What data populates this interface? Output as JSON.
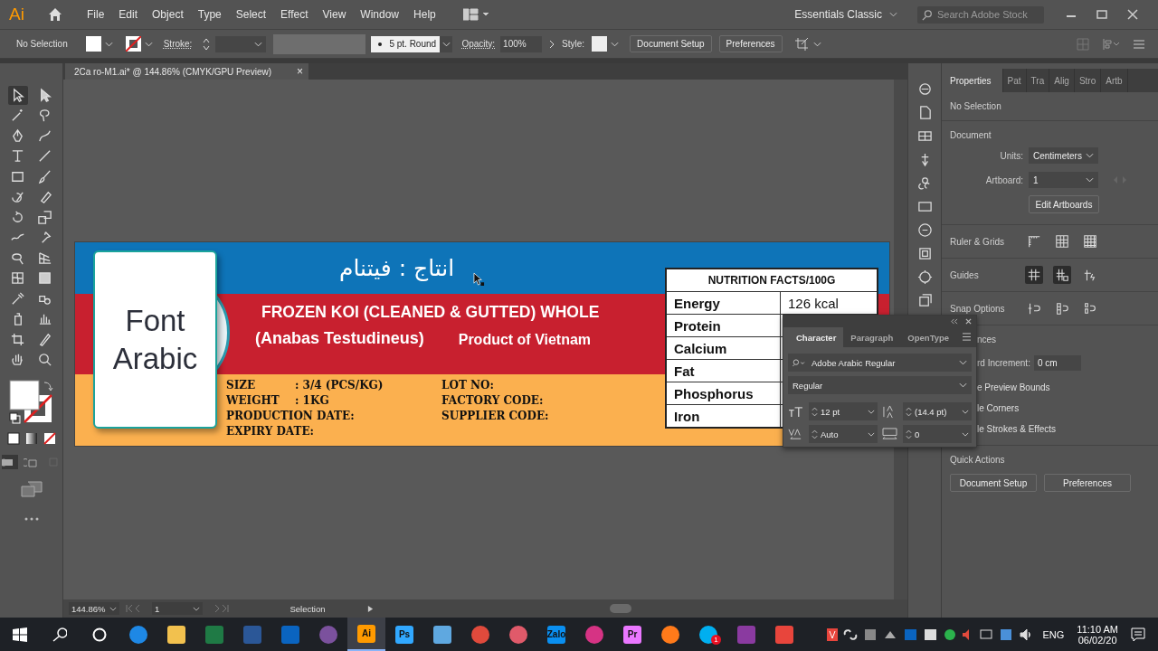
{
  "app": {
    "logo": "Ai"
  },
  "menu": [
    "File",
    "Edit",
    "Object",
    "Type",
    "Select",
    "Effect",
    "View",
    "Window",
    "Help"
  ],
  "workspace": "Essentials Classic",
  "stock_search": {
    "placeholder": "Search Adobe Stock"
  },
  "control_bar": {
    "selection": "No Selection",
    "stroke_label": "Stroke:",
    "brush": "5 pt. Round",
    "opacity_label": "Opacity:",
    "opacity": "100%",
    "style_label": "Style:",
    "buttons": [
      "Document Setup",
      "Preferences"
    ]
  },
  "document_tab": {
    "title": "2Ca ro-M1.ai* @ 144.86% (CMYK/GPU Preview)",
    "close": "×"
  },
  "tools": [
    {
      "kind": "selection",
      "selected": true
    },
    {
      "kind": "direct-selection",
      "selected": false
    },
    {
      "kind": "magic-wand",
      "selected": false
    },
    {
      "kind": "lasso",
      "selected": false
    },
    {
      "kind": "pen",
      "selected": false
    },
    {
      "kind": "curvature",
      "selected": false
    },
    {
      "kind": "type",
      "selected": false
    },
    {
      "kind": "line",
      "selected": false
    },
    {
      "kind": "rectangle",
      "selected": false
    },
    {
      "kind": "paintbrush",
      "selected": false
    },
    {
      "kind": "shaper",
      "selected": false
    },
    {
      "kind": "eraser",
      "selected": false
    },
    {
      "kind": "rotate",
      "selected": false
    },
    {
      "kind": "scale",
      "selected": false
    },
    {
      "kind": "warp",
      "selected": false
    },
    {
      "kind": "puppet-warp",
      "selected": false
    },
    {
      "kind": "free-transform",
      "selected": false
    },
    {
      "kind": "perspective-grid",
      "selected": false
    },
    {
      "kind": "mesh",
      "selected": false
    },
    {
      "kind": "gradient",
      "selected": false
    },
    {
      "kind": "eyedropper",
      "selected": false
    },
    {
      "kind": "blend",
      "selected": false
    },
    {
      "kind": "symbol-sprayer",
      "selected": false
    },
    {
      "kind": "column-graph",
      "selected": false
    },
    {
      "kind": "artboard",
      "selected": false
    },
    {
      "kind": "slice",
      "selected": false
    },
    {
      "kind": "hand",
      "selected": false
    },
    {
      "kind": "zoom",
      "selected": false
    }
  ],
  "artboard": {
    "card_text": [
      "Font",
      "Arabic"
    ],
    "arabic_title": "انتاج : فيتنام",
    "product_title": "FROZEN KOI (CLEANED & GUTTED) WHOLE",
    "species": "(Anabas Testudineus)",
    "origin": "Product of Vietnam",
    "fields_left": [
      {
        "label": "SIZE",
        "value": ": 3/4 (PCS/KG)"
      },
      {
        "label": "WEIGHT",
        "value": ": 1KG"
      },
      {
        "label": "PRODUCTION DATE:"
      },
      {
        "label": "EXPIRY DATE:"
      }
    ],
    "fields_right": [
      {
        "label": "LOT NO:"
      },
      {
        "label": "FACTORY CODE:"
      },
      {
        "label": "SUPPLIER CODE:"
      }
    ],
    "nutrition": {
      "title": "NUTRITION FACTS/100G",
      "rows": [
        {
          "name": "Energy",
          "value": "126 kcal"
        },
        {
          "name": "Protein"
        },
        {
          "name": "Calcium"
        },
        {
          "name": "Fat"
        },
        {
          "name": "Phosphorus"
        },
        {
          "name": "Iron"
        }
      ]
    }
  },
  "status_bar": {
    "zoom": "144.86%",
    "artboard": "1",
    "tool": "Selection"
  },
  "properties": {
    "tabs": [
      {
        "label": "Properties",
        "selected": true
      },
      {
        "label": "Pat",
        "selected": false
      },
      {
        "label": "Tra",
        "selected": false
      },
      {
        "label": "Alig",
        "selected": false
      },
      {
        "label": "Stro",
        "selected": false
      },
      {
        "label": "Artb",
        "selected": false
      }
    ],
    "selection": "No Selection",
    "document": {
      "heading": "Document",
      "units_label": "Units:",
      "units": "Centimeters",
      "artboard_label": "Artboard:",
      "artboard": "1",
      "button": "Edit Artboards"
    },
    "icon_rows": [
      {
        "label": "Ruler & Grids",
        "icons": [
          {
            "kind": "rulers",
            "selected": false
          },
          {
            "kind": "grid",
            "selected": false
          },
          {
            "kind": "transparency-grid",
            "selected": false
          }
        ]
      },
      {
        "label": "Guides",
        "icons": [
          {
            "kind": "guides",
            "selected": true
          },
          {
            "kind": "lock-guides",
            "selected": true
          },
          {
            "kind": "smart-guides",
            "selected": false
          }
        ]
      },
      {
        "label": "Snap Options",
        "icons": [
          {
            "kind": "snap-point",
            "selected": false
          },
          {
            "kind": "snap-pixel",
            "selected": false
          },
          {
            "kind": "snap-glyph",
            "selected": false
          }
        ]
      }
    ],
    "preferences": {
      "heading": "nces",
      "increment_label": "rd Increment:",
      "increment": "0 cm",
      "options": [
        "e Preview Bounds",
        "le Corners",
        "le Strokes & Effects"
      ]
    },
    "quick_actions": {
      "heading": "Quick Actions",
      "buttons": [
        "Document Setup",
        "Preferences"
      ]
    }
  },
  "character_panel": {
    "tabs": [
      {
        "label": "Character",
        "selected": true
      },
      {
        "label": "Paragraph",
        "selected": false
      },
      {
        "label": "OpenType",
        "selected": false
      }
    ],
    "font": "Adobe Arabic Regular",
    "style": "Regular",
    "size": "12 pt",
    "leading": "(14.4 pt)",
    "kerning": "Auto",
    "tracking": "0"
  },
  "taskbar": {
    "apps": [
      {
        "kind": "edge",
        "color": "#1e88e5",
        "selected": false
      },
      {
        "kind": "explorer",
        "color": "#f2c14e",
        "selected": false
      },
      {
        "kind": "excel",
        "color": "#1f7a45",
        "selected": false
      },
      {
        "kind": "word",
        "color": "#2b5797",
        "selected": false
      },
      {
        "kind": "outlook",
        "color": "#0a64c0",
        "selected": false
      },
      {
        "kind": "viber",
        "color": "#7b519d",
        "selected": false
      },
      {
        "kind": "illustrator",
        "color": "#ff9a00",
        "label": "Ai",
        "selected": true
      },
      {
        "kind": "photoshop",
        "color": "#31a8ff",
        "label": "Ps",
        "selected": false
      },
      {
        "kind": "app",
        "color": "#5fa8e0",
        "selected": false
      },
      {
        "kind": "chrome",
        "color": "#e04a3c",
        "selected": false
      },
      {
        "kind": "snip",
        "color": "#e05a6a",
        "selected": false
      },
      {
        "kind": "zalo",
        "color": "#0a8ff0",
        "label": "Zalo",
        "selected": false
      },
      {
        "kind": "music",
        "color": "#d63384",
        "selected": false
      },
      {
        "kind": "premiere",
        "color": "#ea77ff",
        "label": "Pr",
        "selected": false
      },
      {
        "kind": "firefox",
        "color": "#ff7a1a",
        "selected": false
      },
      {
        "kind": "skype",
        "color": "#00aff0",
        "badge": "1",
        "selected": false
      },
      {
        "kind": "archive",
        "color": "#8a3aa0",
        "selected": false
      },
      {
        "kind": "red-app",
        "color": "#e8453c",
        "selected": false
      }
    ],
    "language": "ENG",
    "time": "11:10 AM",
    "date": "06/02/20"
  }
}
